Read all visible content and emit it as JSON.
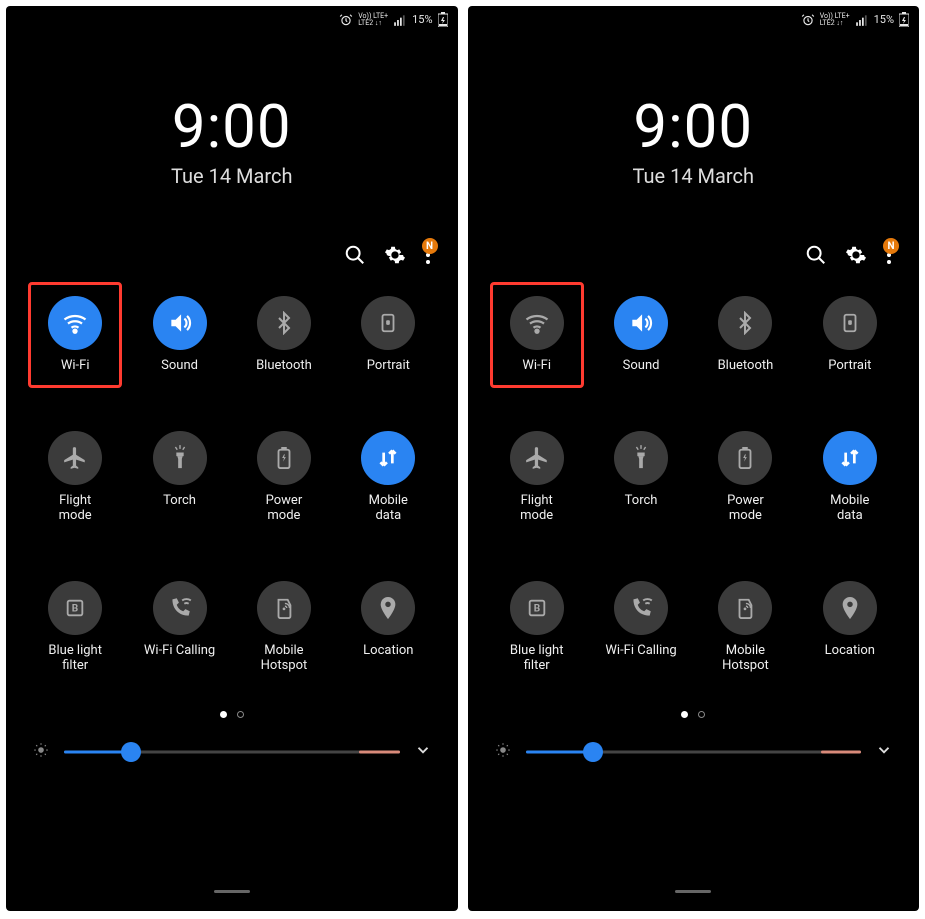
{
  "status": {
    "lte_top": "Vo)) LTE+",
    "lte_bottom": "LTE2 ↓↑",
    "battery_pct": "15%"
  },
  "clock": {
    "time": "9:00",
    "date": "Tue 14 March"
  },
  "actions": {
    "badge": "N"
  },
  "toggles": [
    {
      "id": "wifi",
      "label": "Wi-Fi"
    },
    {
      "id": "sound",
      "label": "Sound"
    },
    {
      "id": "bluetooth",
      "label": "Bluetooth"
    },
    {
      "id": "portrait",
      "label": "Portrait"
    },
    {
      "id": "flight",
      "label": "Flight\nmode"
    },
    {
      "id": "torch",
      "label": "Torch"
    },
    {
      "id": "power",
      "label": "Power\nmode"
    },
    {
      "id": "mobiledata",
      "label": "Mobile\ndata"
    },
    {
      "id": "bluelight",
      "label": "Blue light\nfilter"
    },
    {
      "id": "wificalling",
      "label": "Wi-Fi Calling"
    },
    {
      "id": "hotspot",
      "label": "Mobile\nHotspot"
    },
    {
      "id": "location",
      "label": "Location"
    }
  ],
  "panels": [
    {
      "wifi_active": true,
      "brightness_pct": 20
    },
    {
      "wifi_active": false,
      "brightness_pct": 20
    }
  ],
  "active_map_common": {
    "sound": true,
    "mobiledata": true,
    "bluetooth": false,
    "portrait": false,
    "flight": false,
    "torch": false,
    "power": false,
    "bluelight": false,
    "wificalling": false,
    "hotspot": false,
    "location": false
  }
}
